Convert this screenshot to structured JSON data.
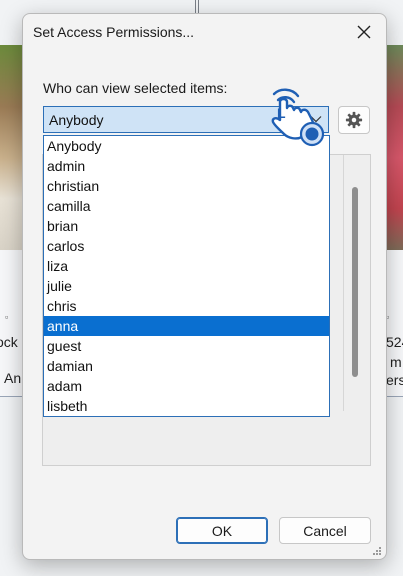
{
  "background": {
    "left_text": [
      "ock",
      "An"
    ],
    "right_text": [
      "524",
      "m",
      "ers"
    ],
    "thumb_marker": "▫"
  },
  "dialog": {
    "title": "Set Access Permissions...",
    "close_icon": "close-icon",
    "who_label": "Who can view selected items:",
    "combo": {
      "selected_value": "Anybody",
      "options": [
        "Anybody",
        "admin",
        "christian",
        "camilla",
        "brian",
        "carlos",
        "liza",
        "julie",
        "chris",
        "anna",
        "guest",
        "damian",
        "adam",
        "lisbeth"
      ],
      "highlighted_option": "anna"
    },
    "gear_icon": "gear-icon",
    "buttons": {
      "ok": "OK",
      "cancel": "Cancel"
    },
    "cursor_hint": "L"
  },
  "colors": {
    "accent": "#0a6fd0",
    "combo_bg": "#cfe3f6",
    "focus_border": "#2c6fb7"
  }
}
